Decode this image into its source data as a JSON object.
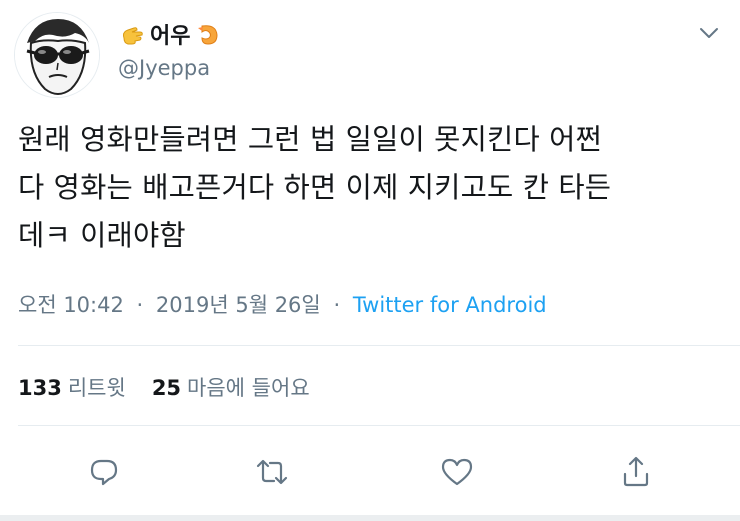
{
  "header": {
    "display_name": "어우",
    "handle": "@Jyeppa",
    "left_emoji": "hand-emoji-icon",
    "right_emoji": "shrimp-emoji-icon"
  },
  "tweet": {
    "lines": [
      "원래 영화만들려면 그런 법 일일이 못지킨다 어쩐",
      "다 영화는 배고픈거다 하면 이제 지키고도 칸 타든",
      "데ㅋ 이래야함"
    ]
  },
  "meta": {
    "time": "오전 10:42",
    "date": "2019년 5월 26일",
    "separator": "·",
    "source": "Twitter for Android"
  },
  "stats": {
    "retweet_count": "133",
    "retweet_label": "리트윗",
    "like_count": "25",
    "like_label": "마음에 들어요"
  },
  "colors": {
    "text": "#14171a",
    "muted": "#657786",
    "accent": "#1da1f2",
    "divider": "#e6ecf0"
  },
  "actions": [
    "reply-icon",
    "retweet-icon",
    "like-icon",
    "share-icon"
  ]
}
